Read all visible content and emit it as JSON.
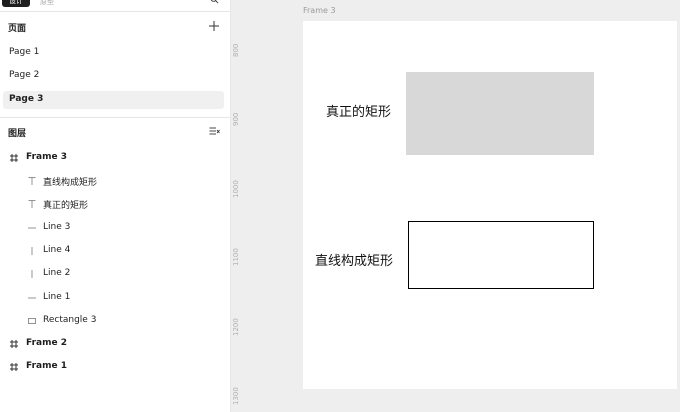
{
  "topbar": {
    "tab_design": "设计",
    "tab_other": "原型"
  },
  "pages": {
    "title": "页面",
    "items": [
      {
        "label": "Page 1",
        "selected": false
      },
      {
        "label": "Page 2",
        "selected": false
      },
      {
        "label": "Page 3",
        "selected": true
      }
    ]
  },
  "layers": {
    "title": "图层",
    "items": [
      {
        "label": "Frame 3",
        "icon": "frame-icon"
      },
      {
        "label": "直线构成矩形",
        "icon": "text-icon"
      },
      {
        "label": "真正的矩形",
        "icon": "text-icon"
      },
      {
        "label": "Line 3",
        "icon": "horizontal-line-icon"
      },
      {
        "label": "Line 4",
        "icon": "vertical-line-icon"
      },
      {
        "label": "Line 2",
        "icon": "vertical-line-icon"
      },
      {
        "label": "Line 1",
        "icon": "horizontal-line-icon"
      },
      {
        "label": "Rectangle 3",
        "icon": "rectangle-icon"
      },
      {
        "label": "Frame 2",
        "icon": "frame-icon"
      },
      {
        "label": "Frame 1",
        "icon": "frame-icon"
      }
    ]
  },
  "canvas": {
    "frame_label": "Frame 3",
    "ruler_labels": [
      "800",
      "900",
      "1000",
      "1100",
      "1200",
      "1300"
    ],
    "text_real_rect": "真正的矩形",
    "text_line_rect": "直线构成矩形",
    "colors": {
      "canvas_bg": "#eeeeee",
      "frame_bg": "#ffffff",
      "filled_rect": "#d8d8d8",
      "line_stroke": "#000000"
    }
  }
}
